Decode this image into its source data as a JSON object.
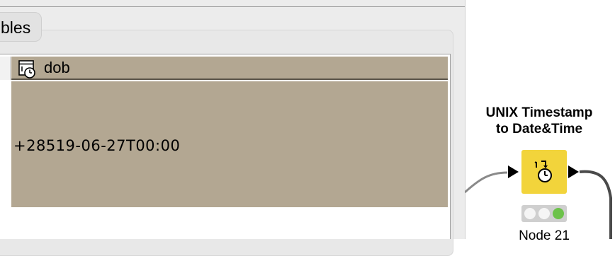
{
  "dialog": {
    "tab_label": "bles",
    "table": {
      "columns": [
        {
          "name": "dob",
          "icon": "datetime-column-icon"
        }
      ],
      "rows": [
        [
          "+28519-06-27T00:00"
        ]
      ]
    }
  },
  "workflow": {
    "node": {
      "title_line1": "UNIX Timestamp",
      "title_line2": "to Date&Time",
      "label": "Node 21",
      "icon": "clock-convert-icon",
      "color": "#f2d43b",
      "status": {
        "red": "off",
        "yellow": "off",
        "green": "on"
      },
      "status_colors": {
        "off": "#f5f5f5",
        "green": "#6cc24a"
      }
    }
  },
  "colors": {
    "column_header": "#b3a792",
    "cell_background": "#b3a792",
    "dialog_background": "#ececec"
  }
}
